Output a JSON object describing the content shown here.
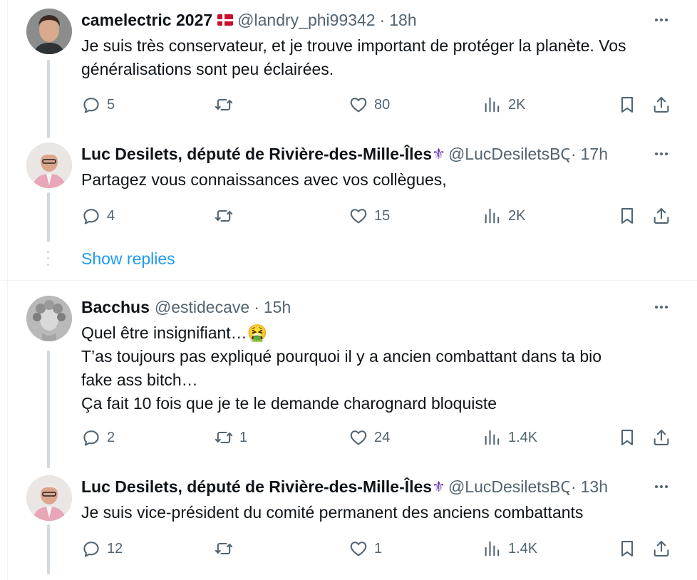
{
  "tweets": [
    {
      "name": "camelectric 2027",
      "flag": "denmark-flag",
      "handle": "@landry_phi99342",
      "time": "18h",
      "lines": [
        "Je suis très conservateur, et je trouve important de protéger la planète. Vos",
        "généralisations sont peu éclairées."
      ],
      "replies": "5",
      "retweets": "",
      "likes": "80",
      "views": "2K"
    },
    {
      "name": "Luc Desilets, député de Rivière-des-Mille-Îles",
      "emoji": "⚜",
      "handle": "@LucDesiletsBQ",
      "time": "17h",
      "lines": [
        "Partagez vous connaissances avec vos collègues,"
      ],
      "replies": "4",
      "retweets": "",
      "likes": "15",
      "views": "2K"
    },
    {
      "name": "Bacchus",
      "handle": "@estidecave",
      "time": "15h",
      "lines": [
        "Quel être insignifiant…🤮",
        "T’as toujours pas expliqué pourquoi il y a ancien combattant dans ta bio",
        "fake ass bitch…",
        "Ça fait 10 fois que je te le demande charognard bloquiste"
      ],
      "replies": "2",
      "retweets": "1",
      "likes": "24",
      "views": "1.4K"
    },
    {
      "name": "Luc Desilets, député de Rivière-des-Mille-Îles",
      "emoji": "⚜",
      "handle": "@LucDesiletsBQ",
      "time": "13h",
      "lines": [
        "Je suis vice-président du comité permanent des anciens combattants"
      ],
      "replies": "12",
      "retweets": "",
      "likes": "1",
      "views": "1.4K"
    }
  ],
  "show_replies": "Show replies",
  "separator": "·",
  "colors": {
    "text": "#0f1419",
    "muted": "#536471",
    "link": "#1d9bf0",
    "line": "#cfd9de",
    "fleur": "#6a3fb0"
  }
}
